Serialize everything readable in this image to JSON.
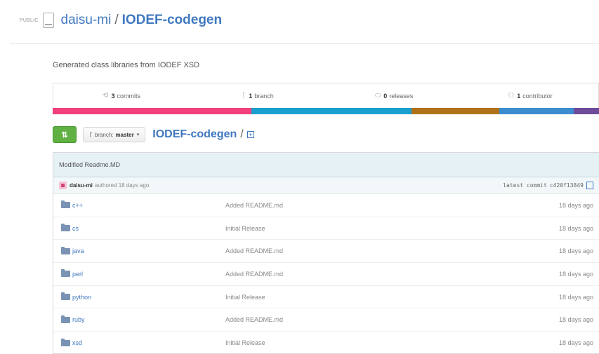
{
  "header": {
    "visibility": "PUBLIC",
    "owner": "daisu-mi",
    "separator": "/",
    "repo": "IODEF-codegen"
  },
  "description": "Generated class libraries from IODEF XSD",
  "summary": [
    {
      "icon": "commits-icon",
      "count": "3",
      "label": "commits"
    },
    {
      "icon": "branch-icon",
      "count": "1",
      "label": "branch"
    },
    {
      "icon": "tag-icon",
      "count": "0",
      "label": "releases"
    },
    {
      "icon": "contributors-icon",
      "count": "1",
      "label": "contributor"
    }
  ],
  "language_bar": [
    {
      "color": "#f1407a",
      "share": 0.364
    },
    {
      "color": "#1a9fcf",
      "share": 0.293
    },
    {
      "color": "#b07219",
      "share": 0.16
    },
    {
      "color": "#3c8dd0",
      "share": 0.137
    },
    {
      "color": "#6e4c9a",
      "share": 0.046
    }
  ],
  "toolbar": {
    "compare_icon": "compare-icon",
    "branch_prefix": "branch:",
    "branch_name": "master",
    "breadcrumb_root": "IODEF-codegen",
    "breadcrumb_sep": "/",
    "add_file_icon": "+"
  },
  "commit": {
    "message": "Modified Readme.MD",
    "author": "daisu-mi",
    "authored": "authored 18 days ago",
    "latest_label": "latest commit",
    "sha": "c420f13849"
  },
  "files": [
    {
      "name": "c++",
      "message": "Added README.md",
      "age": "18 days ago"
    },
    {
      "name": "cs",
      "message": "Initial Release",
      "age": "18 days ago"
    },
    {
      "name": "java",
      "message": "Added README.md",
      "age": "18 days ago"
    },
    {
      "name": "perl",
      "message": "Added README.md",
      "age": "18 days ago"
    },
    {
      "name": "python",
      "message": "Initial Release",
      "age": "18 days ago"
    },
    {
      "name": "ruby",
      "message": "Added README.md",
      "age": "18 days ago"
    },
    {
      "name": "xsd",
      "message": "Initial Release",
      "age": "18 days ago"
    }
  ]
}
